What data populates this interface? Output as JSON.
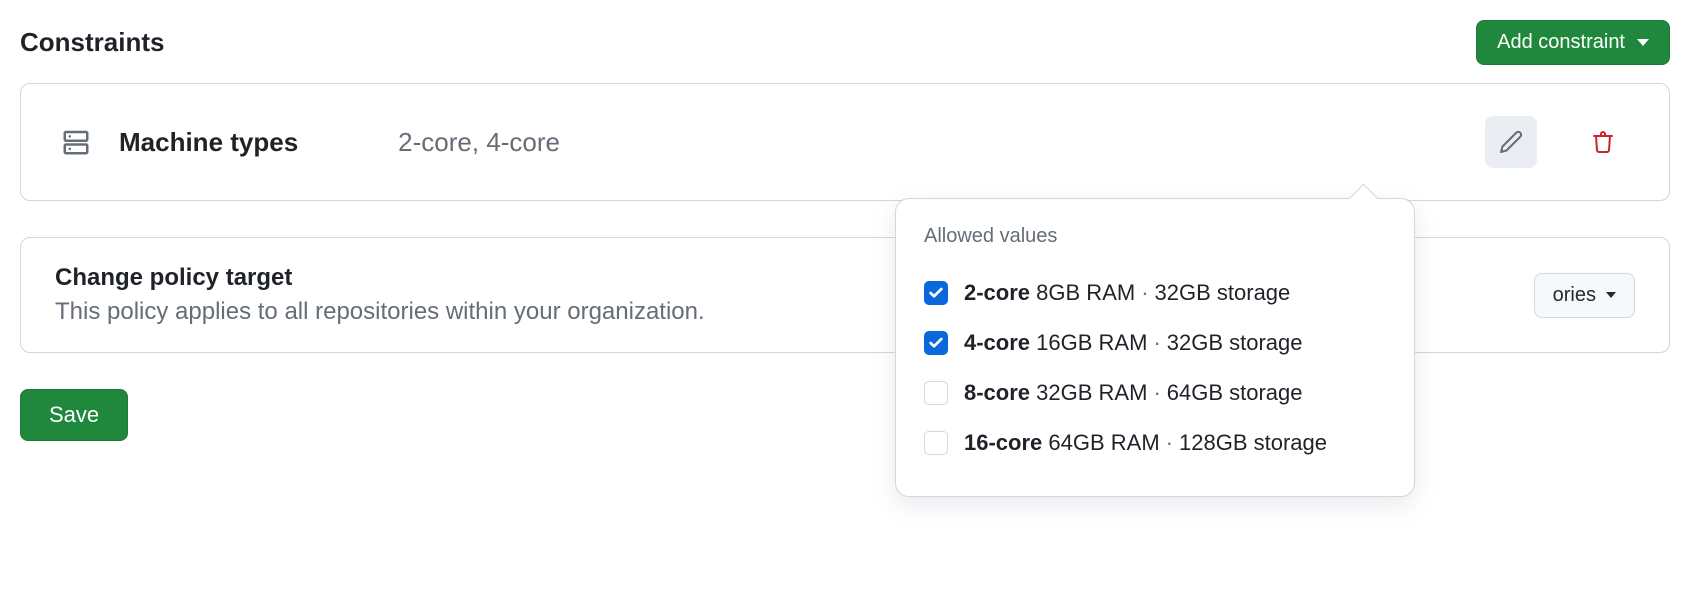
{
  "header": {
    "title": "Constraints",
    "add_button": "Add constraint"
  },
  "constraint": {
    "name": "Machine types",
    "summary": "2-core, 4-core"
  },
  "popover": {
    "title": "Allowed values",
    "options": [
      {
        "checked": true,
        "cores": "2-core",
        "ram": "8GB RAM",
        "storage": "32GB storage"
      },
      {
        "checked": true,
        "cores": "4-core",
        "ram": "16GB RAM",
        "storage": "32GB storage"
      },
      {
        "checked": false,
        "cores": "8-core",
        "ram": "32GB RAM",
        "storage": "64GB storage"
      },
      {
        "checked": false,
        "cores": "16-core",
        "ram": "64GB RAM",
        "storage": "128GB storage"
      }
    ]
  },
  "policy": {
    "title": "Change policy target",
    "description": "This policy applies to all repositories within your organization.",
    "select_visible": "ories"
  },
  "actions": {
    "save": "Save"
  }
}
